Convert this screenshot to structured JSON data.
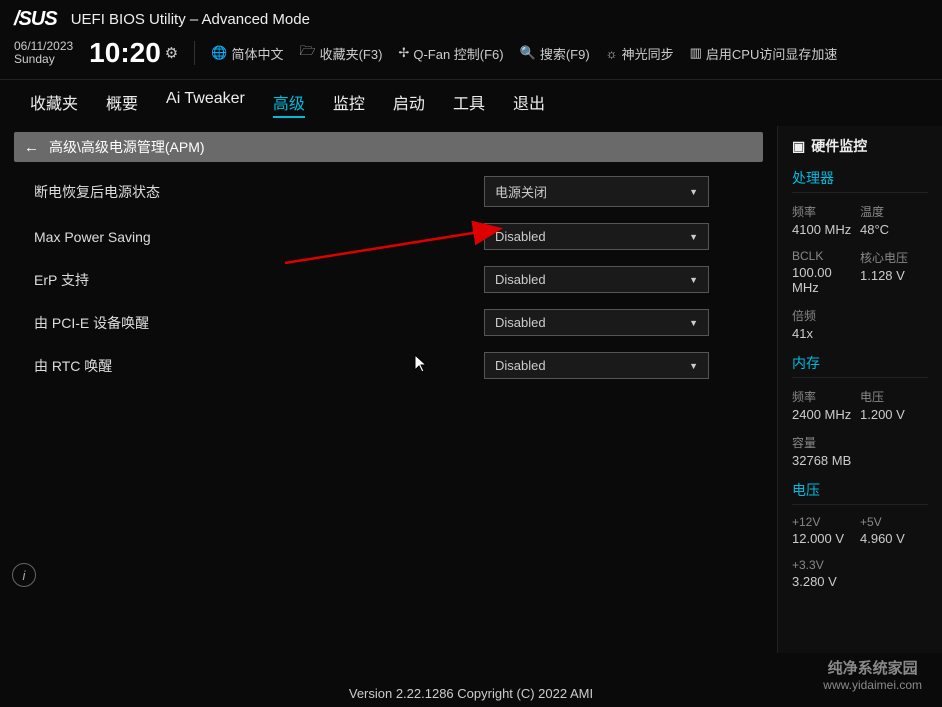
{
  "header": {
    "logo": "/SUS",
    "title": "UEFI BIOS Utility – Advanced Mode"
  },
  "toolbar": {
    "date": "06/11/2023",
    "day": "Sunday",
    "time": "10:20",
    "lang": "简体中文",
    "favorites": "收藏夹(F3)",
    "qfan": "Q-Fan 控制(F6)",
    "search": "搜索(F9)",
    "aura": "神光同步",
    "resize_bar": "启用CPU访问显存加速"
  },
  "tabs": {
    "favorites": "收藏夹",
    "main": "概要",
    "ai_tweaker": "Ai Tweaker",
    "advanced": "高级",
    "monitor": "监控",
    "boot": "启动",
    "tool": "工具",
    "exit": "退出"
  },
  "breadcrumb": "高级\\高级电源管理(APM)",
  "settings": [
    {
      "label": "断电恢复后电源状态",
      "value": "电源关闭"
    },
    {
      "label": "Max Power Saving",
      "value": "Disabled"
    },
    {
      "label": "ErP 支持",
      "value": "Disabled"
    },
    {
      "label": "由 PCI-E 设备唤醒",
      "value": "Disabled"
    },
    {
      "label": "由 RTC 唤醒",
      "value": "Disabled"
    }
  ],
  "sidebar": {
    "title": "硬件监控",
    "cpu": {
      "title": "处理器",
      "freq_label": "频率",
      "freq": "4100 MHz",
      "temp_label": "温度",
      "temp": "48°C",
      "bclk_label": "BCLK",
      "bclk": "100.00 MHz",
      "vcore_label": "核心电压",
      "vcore": "1.128 V",
      "ratio_label": "倍频",
      "ratio": "41x"
    },
    "memory": {
      "title": "内存",
      "freq_label": "频率",
      "freq": "2400 MHz",
      "volt_label": "电压",
      "volt": "1.200 V",
      "cap_label": "容量",
      "cap": "32768 MB"
    },
    "voltage": {
      "title": "电压",
      "v12_label": "+12V",
      "v12": "12.000 V",
      "v5_label": "+5V",
      "v5": "4.960 V",
      "v33_label": "+3.3V",
      "v33": "3.280 V"
    }
  },
  "footer": "Version 2.22.1286 Copyright (C) 2022 AMI",
  "watermark": {
    "name": "纯净系统家园",
    "url": "www.yidaimei.com"
  }
}
